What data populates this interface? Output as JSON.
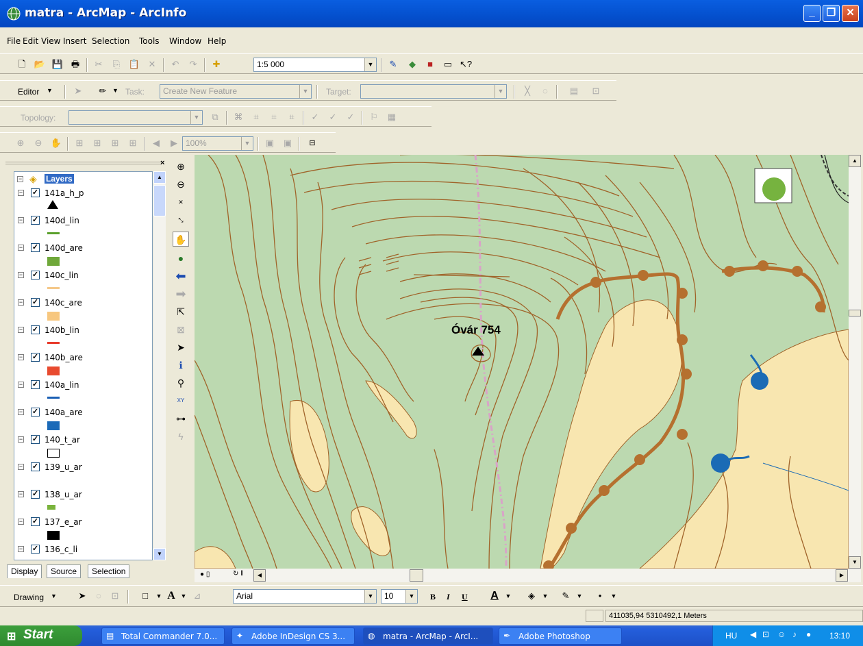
{
  "window": {
    "title": "matra - ArcMap - ArcInfo",
    "min": "_",
    "max": "❐",
    "close": "✕"
  },
  "menu": [
    "File",
    "Edit",
    "View",
    "Insert",
    "Selection",
    "Tools",
    "Window",
    "Help"
  ],
  "standard": {
    "scale": "1:5 000"
  },
  "editor": {
    "label": "Editor",
    "task_label": "Task:",
    "task_value": "Create New Feature",
    "target_label": "Target:"
  },
  "topology": {
    "label": "Topology:"
  },
  "layout": {
    "zoom": "100%"
  },
  "toc": {
    "root": "Layers",
    "layers": [
      {
        "name": "141a_h_p",
        "symbol": "triangle",
        "color": "#000000"
      },
      {
        "name": "140d_lin",
        "symbol": "line",
        "color": "#5aa02c"
      },
      {
        "name": "140d_are",
        "symbol": "fill",
        "color": "#6fa83a"
      },
      {
        "name": "140c_lin",
        "symbol": "line",
        "color": "#f5c88a"
      },
      {
        "name": "140c_are",
        "symbol": "fill",
        "color": "#f7c77f"
      },
      {
        "name": "140b_lin",
        "symbol": "line",
        "color": "#e8392a"
      },
      {
        "name": "140b_are",
        "symbol": "fill",
        "color": "#e84a2f"
      },
      {
        "name": "140a_lin",
        "symbol": "line",
        "color": "#1a5fb4"
      },
      {
        "name": "140a_are",
        "symbol": "fill",
        "color": "#1b6ab8"
      },
      {
        "name": "140_t_ar",
        "symbol": "outline",
        "color": "#ffffff"
      },
      {
        "name": "139_u_ar",
        "symbol": "none",
        "color": "#ffffff"
      },
      {
        "name": "138_u_ar",
        "symbol": "smallfill",
        "color": "#7ab33c"
      },
      {
        "name": "137_e_ar",
        "symbol": "fill",
        "color": "#000000"
      },
      {
        "name": "136_c_li",
        "symbol": "line",
        "color": "#000000"
      }
    ],
    "tabs": [
      "Display",
      "Source",
      "Selection"
    ]
  },
  "map": {
    "peak_label": "Óvár 754",
    "colors": {
      "background": "#bcd9b0",
      "contour": "#a0642a",
      "yellow": "#f8e6b0",
      "trail": "#b5702f",
      "water": "#1b6bb5",
      "path": "#d9a3c8",
      "green": "#76b33f"
    }
  },
  "drawing": {
    "label": "Drawing",
    "font": "Arial",
    "size": "10",
    "bold": "B",
    "italic": "I",
    "underline": "U"
  },
  "status": {
    "coords": "411035,94  5310492,1 Meters"
  },
  "taskbar": {
    "start": "Start",
    "tasks": [
      "Total Commander 7.0...",
      "Adobe InDesign CS 3...",
      "matra - ArcMap - ArcI...",
      "Adobe Photoshop"
    ],
    "lang": "HU",
    "clock": "13:10"
  }
}
